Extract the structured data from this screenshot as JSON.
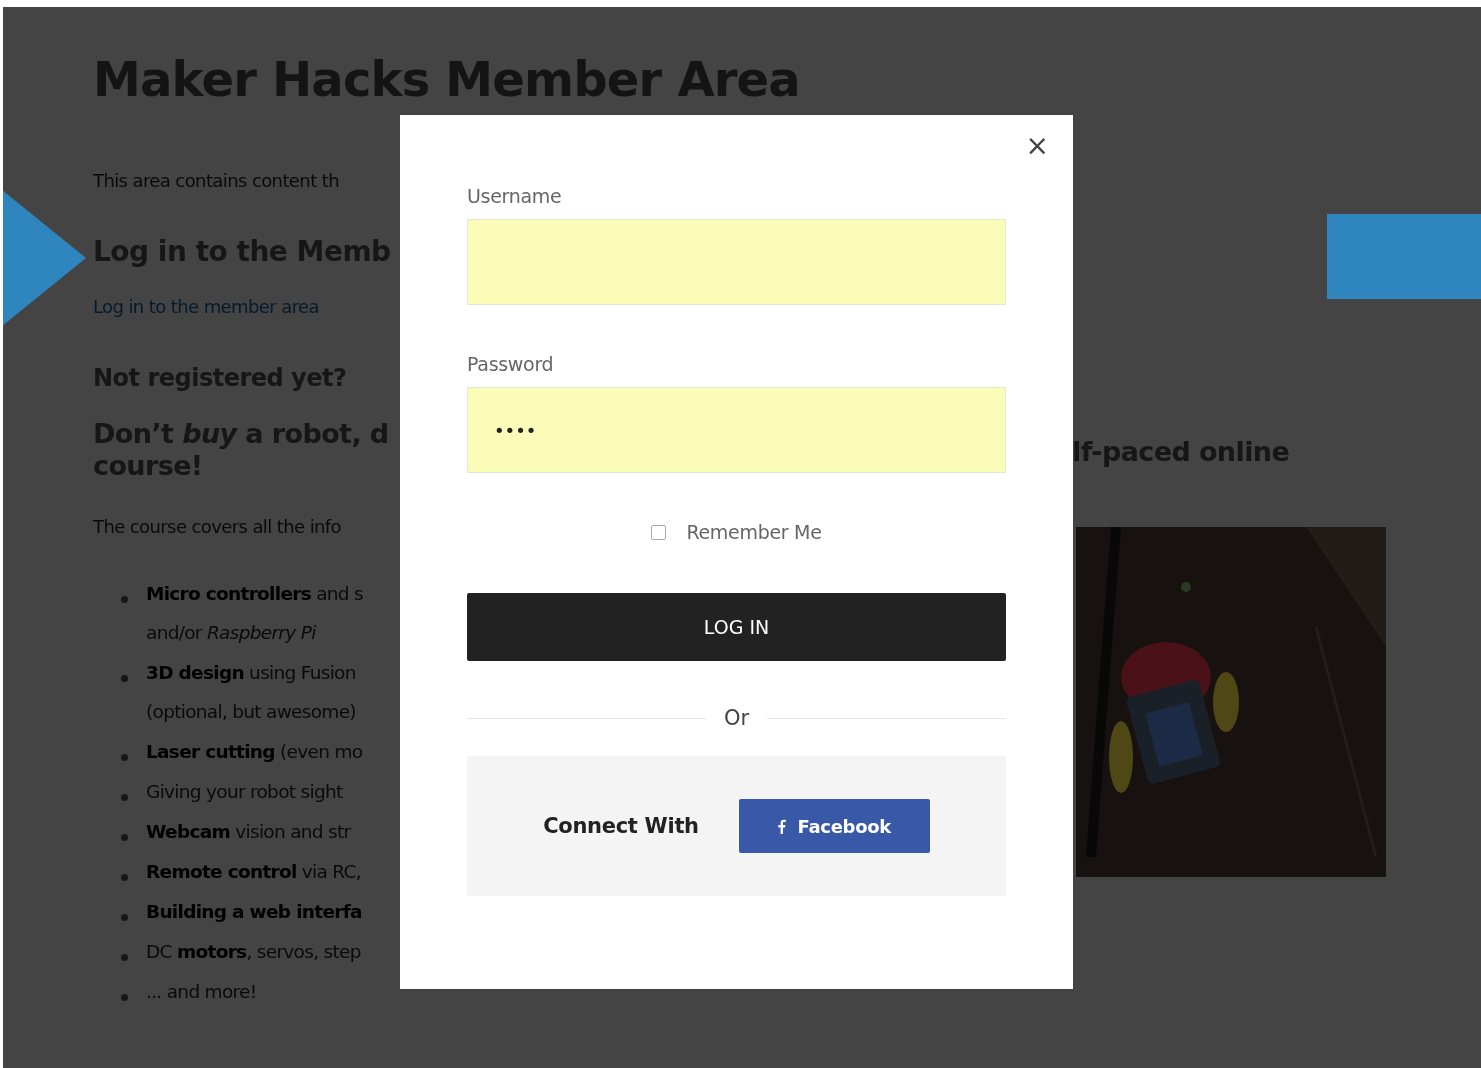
{
  "page": {
    "title": "Maker Hacks Member Area",
    "intro": "This area contains content th",
    "login_heading": "Log in to the Memb",
    "login_link": "Log in to the member area",
    "not_registered": "Not registered yet?",
    "course_heading": {
      "left": "Don’t *buy* a robot, d",
      "right": "lf-paced online",
      "line2": "course!"
    },
    "course_intro": "The course covers all the info",
    "features": [
      {
        "lines": [
          "**Micro controllers** and s",
          "and/or *Raspberry Pi*"
        ]
      },
      {
        "lines": [
          "**3D design** using Fusion",
          "(optional, but awesome)"
        ]
      },
      {
        "lines": [
          "**Laser cutting** (even mo"
        ]
      },
      {
        "lines": [
          "Giving your robot sight"
        ]
      },
      {
        "lines": [
          "**Webcam** vision and str"
        ]
      },
      {
        "lines": [
          "**Remote control** via RC,"
        ]
      },
      {
        "lines": [
          "**Building a web interfa**"
        ]
      },
      {
        "lines": [
          "DC **motors**, servos, step"
        ]
      },
      {
        "lines": [
          "... and more!"
        ]
      }
    ]
  },
  "modal": {
    "close": "×",
    "username": {
      "label": "Username"
    },
    "password": {
      "label": "Password",
      "value": "••••"
    },
    "remember": {
      "label": "Remember Me",
      "checked": false
    },
    "login_button": "LOG IN",
    "or": "Or",
    "connect_label": "Connect With",
    "facebook_button": "Facebook"
  }
}
